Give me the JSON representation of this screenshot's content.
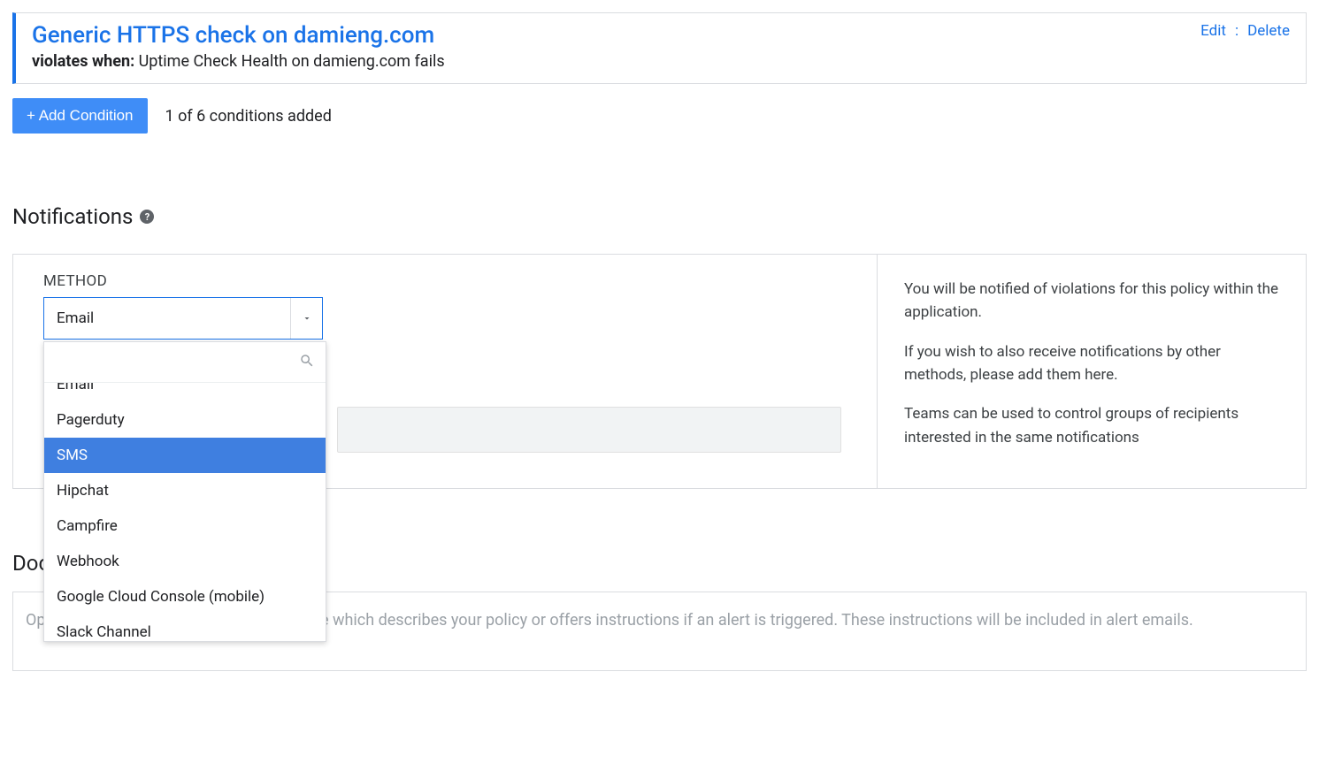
{
  "condition": {
    "title": "Generic HTTPS check on damieng.com",
    "violates_label": "violates when:",
    "violates_text": " Uptime Check Health on damieng.com fails",
    "edit": "Edit",
    "sep": ":",
    "delete": "Delete"
  },
  "add_condition": {
    "button": "+ Add Condition",
    "count": "1 of 6 conditions added"
  },
  "notifications": {
    "heading": "Notifications",
    "help": "?",
    "method_label": "METHOD",
    "selected": "Email",
    "search_placeholder": "",
    "options": [
      {
        "label": "Email",
        "selected": false,
        "clipped": true
      },
      {
        "label": "Pagerduty",
        "selected": false
      },
      {
        "label": "SMS",
        "selected": true
      },
      {
        "label": "Hipchat",
        "selected": false
      },
      {
        "label": "Campfire",
        "selected": false
      },
      {
        "label": "Webhook",
        "selected": false
      },
      {
        "label": "Google Cloud Console (mobile)",
        "selected": false
      },
      {
        "label": "Slack Channel",
        "selected": false
      }
    ],
    "info": {
      "p1": "You will be notified of violations for this policy within the application.",
      "p2": "If you wish to also receive notifications by other methods, please add them here.",
      "p3": "Teams can be used to control groups of recipients interested in the same notifications"
    }
  },
  "documentation": {
    "heading": "Documentation",
    "placeholder": "Optionally add a Markdown document here which describes your policy or offers instructions if an alert is triggered.  These instructions will be included in alert emails."
  }
}
